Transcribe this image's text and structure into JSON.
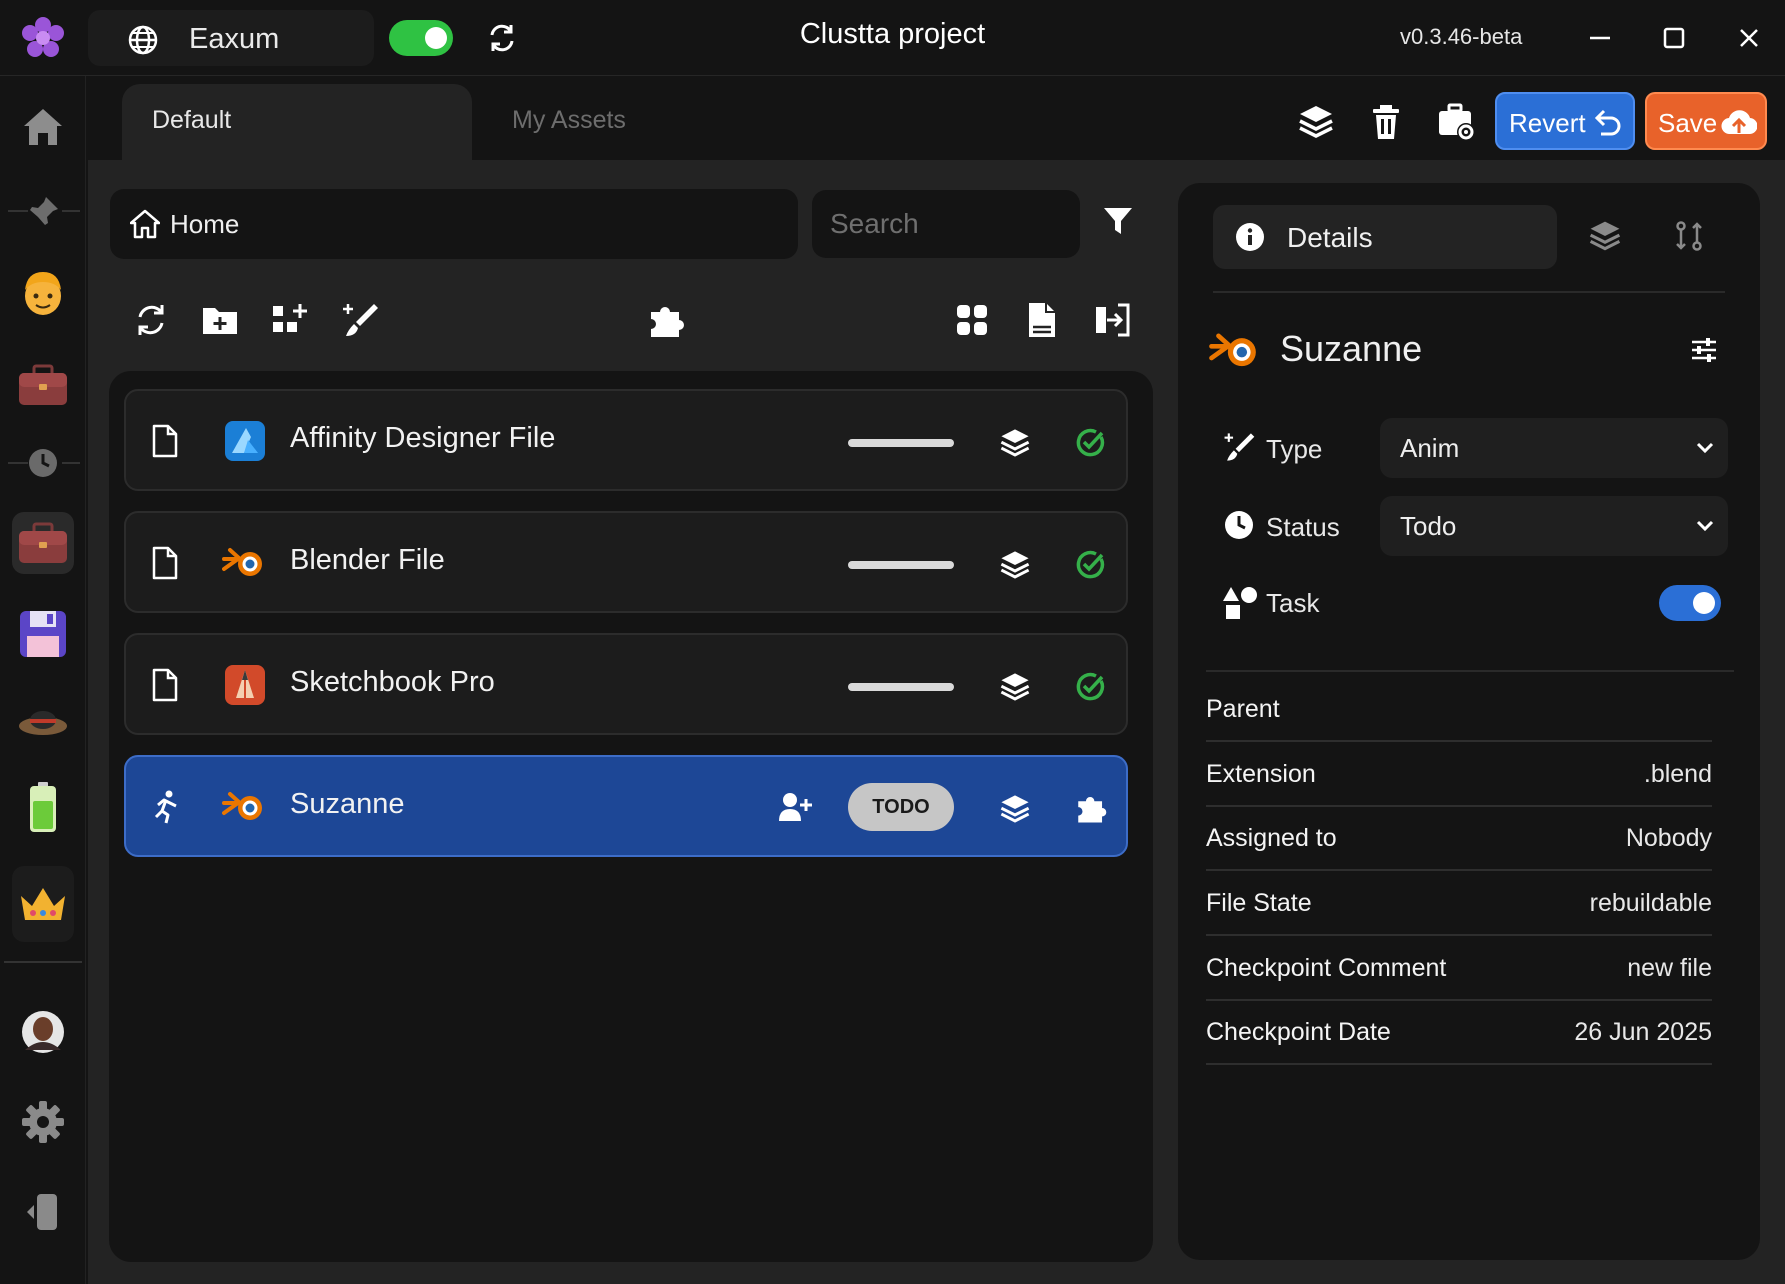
{
  "window": {
    "title": "Clustta project",
    "version": "v0.3.46-beta",
    "workspace": "Eaxum",
    "online_toggle": true
  },
  "sidebar": {
    "items": [
      {
        "name": "home-icon"
      },
      {
        "name": "pin-icon"
      },
      {
        "name": "face-avatar-icon"
      },
      {
        "name": "briefcase-icon"
      },
      {
        "name": "clock-icon"
      },
      {
        "name": "briefcase-active-icon"
      },
      {
        "name": "floppy-disk-icon"
      },
      {
        "name": "hat-icon"
      },
      {
        "name": "battery-icon"
      },
      {
        "name": "crown-icon"
      },
      {
        "name": "user-avatar-icon"
      },
      {
        "name": "settings-gear-icon"
      },
      {
        "name": "collapse-sidebar-icon"
      }
    ]
  },
  "tabs": [
    {
      "label": "Default",
      "active": true
    },
    {
      "label": "My Assets",
      "active": false
    }
  ],
  "toolbar": {
    "revert_label": "Revert",
    "save_label": "Save"
  },
  "browser": {
    "breadcrumb": "Home",
    "search_placeholder": "Search",
    "items": [
      {
        "name": "Affinity Designer File",
        "kind": "file",
        "app": "affinity-designer",
        "progress": 1.0,
        "status": "check"
      },
      {
        "name": "Blender File",
        "kind": "file",
        "app": "blender",
        "progress": 1.0,
        "status": "check"
      },
      {
        "name": "Sketchbook Pro",
        "kind": "file",
        "app": "sketchbook",
        "progress": 1.0,
        "status": "check"
      },
      {
        "name": "Suzanne",
        "kind": "task",
        "app": "blender",
        "badge": "TODO",
        "selected": true
      }
    ]
  },
  "details": {
    "tab_label": "Details",
    "asset_name": "Suzanne",
    "type_label": "Type",
    "type_value": "Anim",
    "status_label": "Status",
    "status_value": "Todo",
    "task_label": "Task",
    "task_enabled": true,
    "properties": [
      {
        "key": "Parent",
        "value": ""
      },
      {
        "key": "Extension",
        "value": ".blend"
      },
      {
        "key": "Assigned to",
        "value": "Nobody"
      },
      {
        "key": "File State",
        "value": "rebuildable"
      },
      {
        "key": "Checkpoint Comment",
        "value": "new file"
      },
      {
        "key": "Checkpoint Date",
        "value": "26 Jun 2025"
      }
    ]
  },
  "colors": {
    "accent_blue": "#2b6fd6",
    "save_orange": "#e8622a",
    "online_green": "#2fc243",
    "check_green": "#35b04a",
    "selected_row": "#1d4796"
  }
}
